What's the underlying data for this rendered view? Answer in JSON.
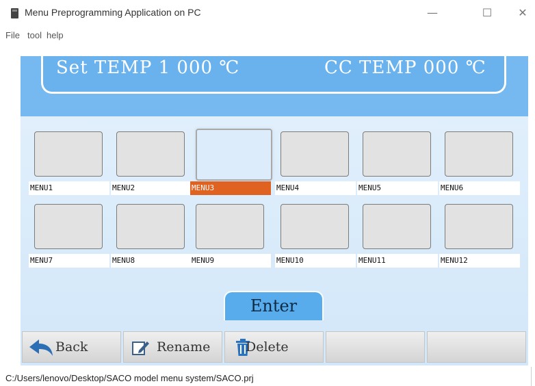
{
  "window": {
    "title": "Menu Preprogramming Application on PC",
    "controls": {
      "minimize": "—",
      "maximize": "☐",
      "close": "✕"
    }
  },
  "menubar": [
    "File",
    "tool",
    "help"
  ],
  "temperature": {
    "set_text": "Set TEMP 1 000 ℃",
    "cc_text": "CC TEMP 000 ℃"
  },
  "menus": [
    {
      "label": "MENU1"
    },
    {
      "label": "MENU2"
    },
    {
      "label": "MENU3",
      "selected": true
    },
    {
      "label": "MENU4"
    },
    {
      "label": "MENU5"
    },
    {
      "label": "MENU6"
    },
    {
      "label": "MENU7"
    },
    {
      "label": "MENU8"
    },
    {
      "label": "MENU9"
    },
    {
      "label": "MENU10"
    },
    {
      "label": "MENU11"
    },
    {
      "label": "MENU12"
    }
  ],
  "enter_label": "Enter",
  "toolbar": {
    "back": "Back",
    "rename": "Rename",
    "delete": "Delete",
    "empty1": "",
    "empty2": ""
  },
  "status_path": "C:/Users/lenovo/Desktop/SACO model menu system/SACO.prj",
  "colors": {
    "panel_blue": "#69b2ee",
    "selected_orange": "#e06220",
    "back_arrow_blue": "#2d6fb4",
    "delete_icon_blue": "#2a73c0"
  }
}
